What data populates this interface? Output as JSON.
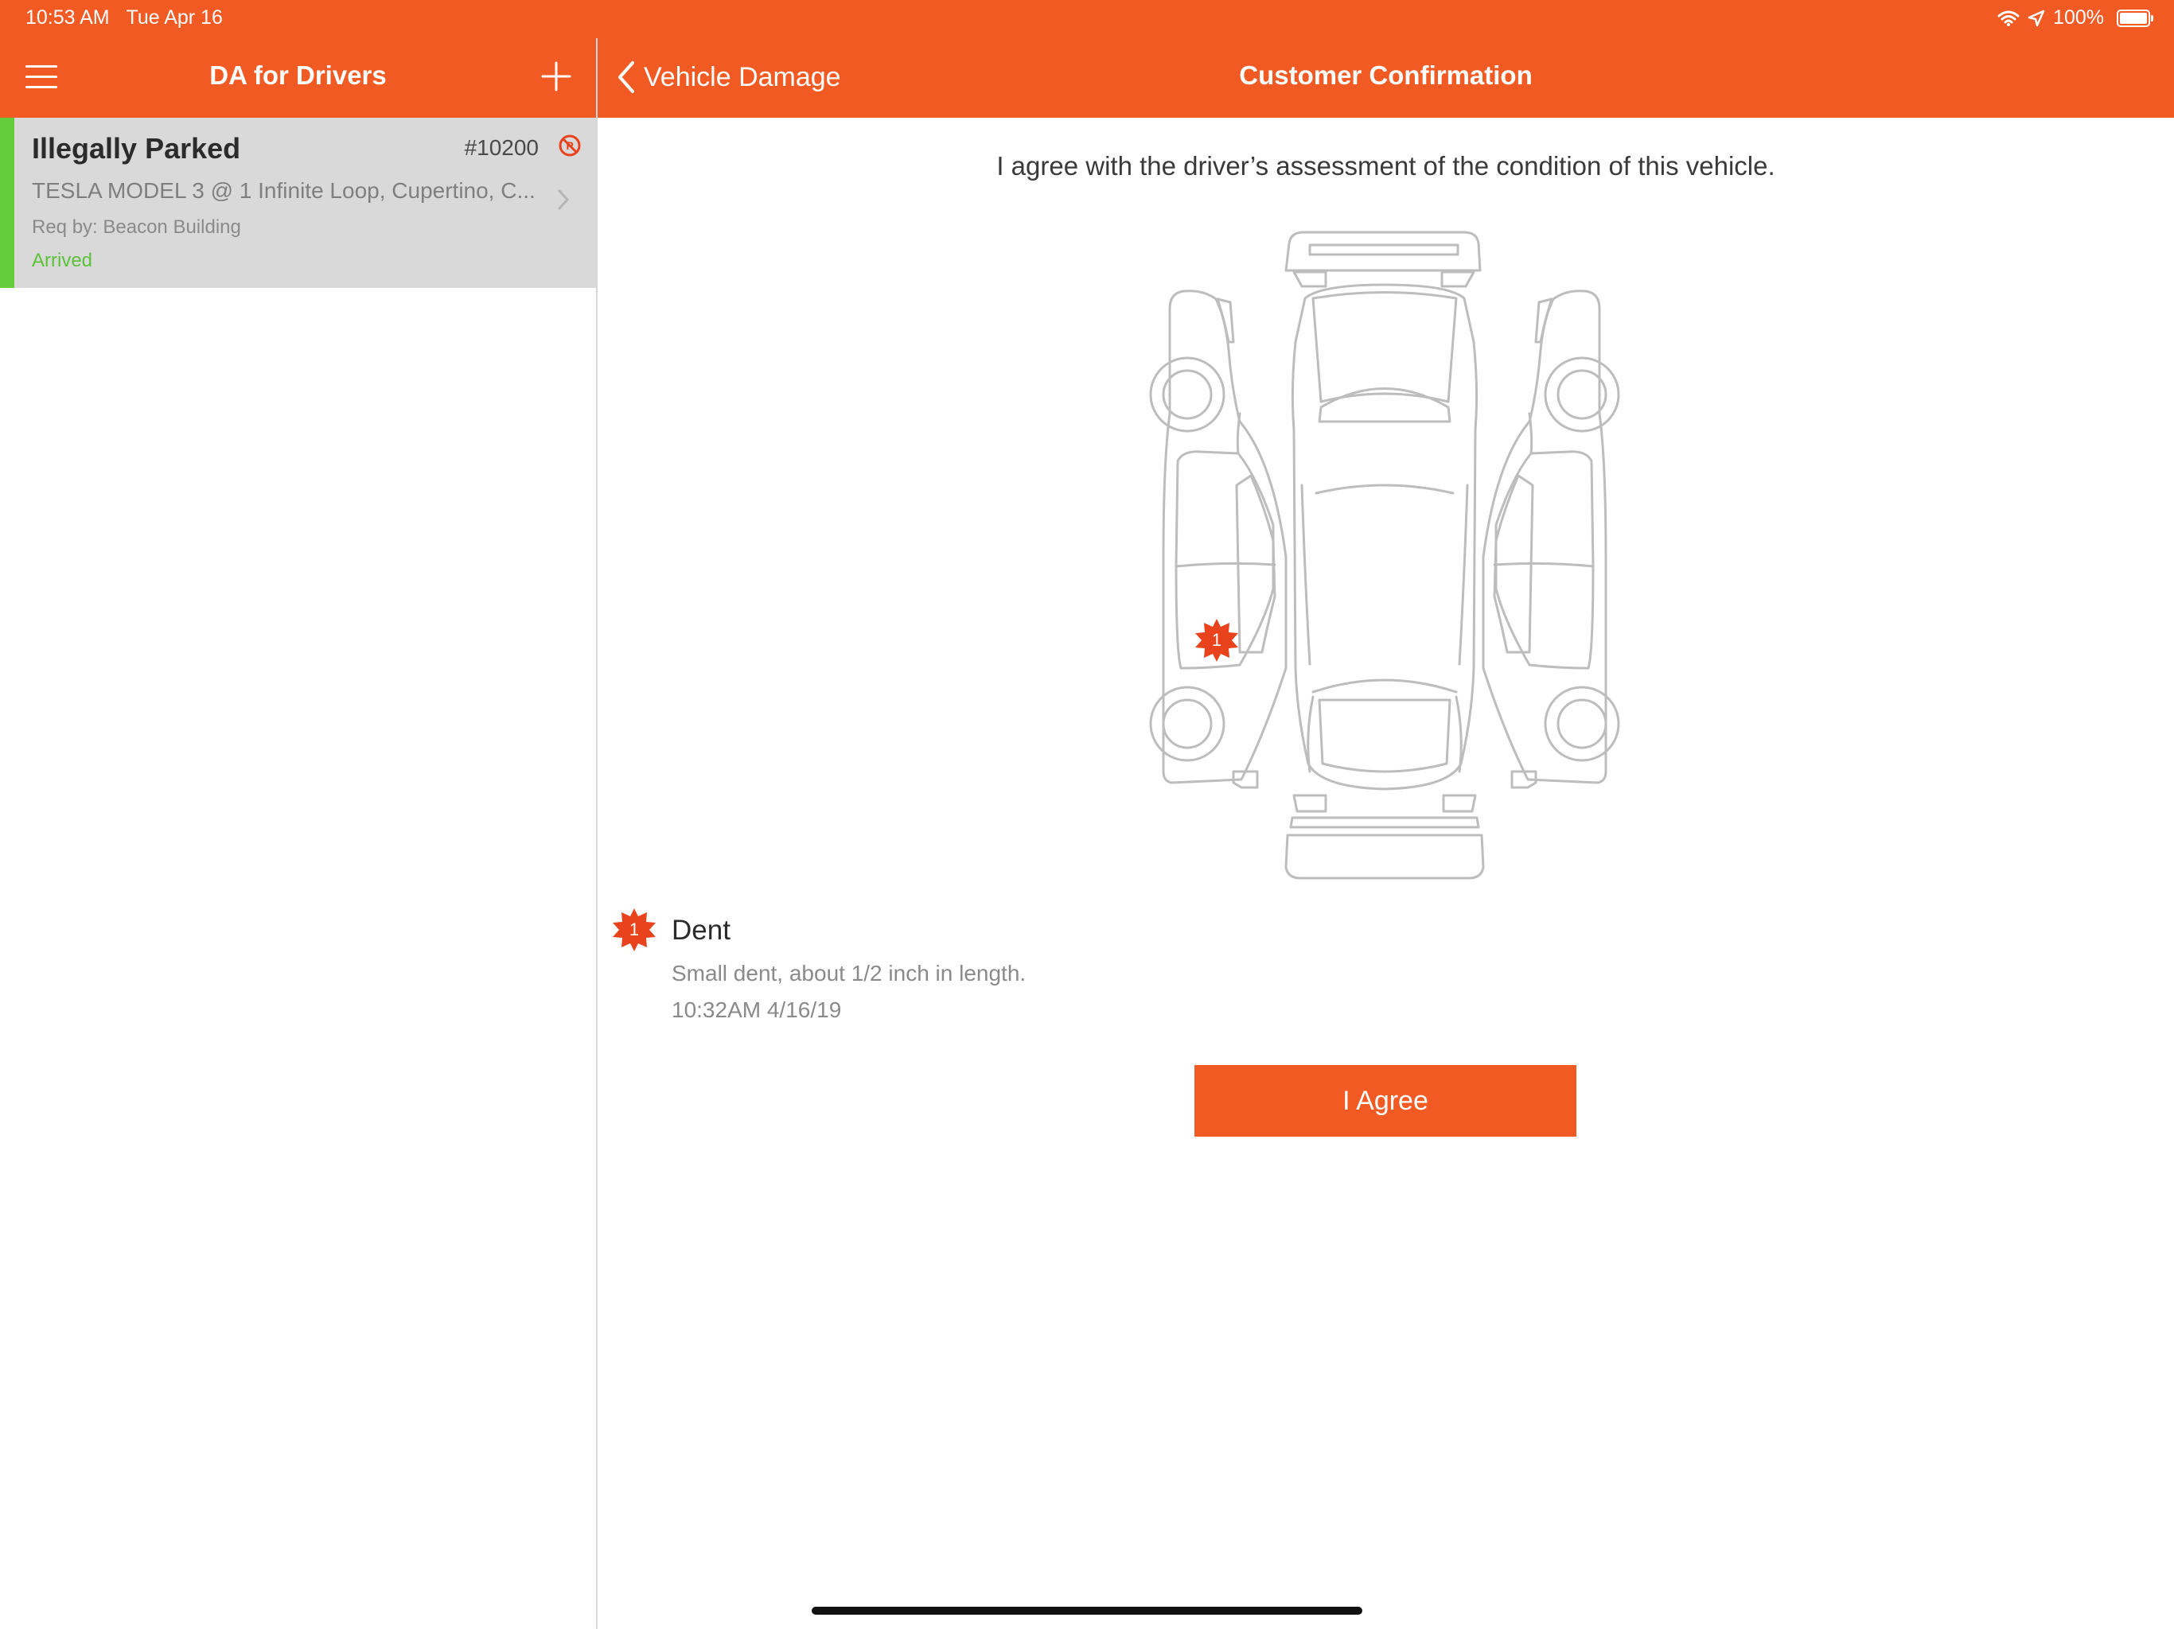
{
  "status_bar": {
    "time": "10:53 AM",
    "date": "Tue Apr 16",
    "battery_percent": "100%"
  },
  "sidebar": {
    "title": "DA for Drivers",
    "menu_icon": "hamburger-menu-icon",
    "add_icon": "plus-icon",
    "jobs": [
      {
        "title": "Illegally Parked",
        "number": "#10200",
        "vehicle_location": "TESLA MODEL 3 @ 1 Infinite Loop, Cupertino, C...",
        "requested_by": "Req by: Beacon Building",
        "status": "Arrived",
        "status_color": "#5cc23a",
        "stripe_color": "#63cc3b",
        "icon": "no-parking-icon"
      }
    ]
  },
  "main": {
    "back_label": "Vehicle Damage",
    "title": "Customer Confirmation",
    "agreement_text": "I agree with the driver’s assessment of the condition of this vehicle.",
    "damages": [
      {
        "index": "1",
        "type": "Dent",
        "description": "Small dent, about 1/2 inch in length.",
        "timestamp": "10:32AM 4/16/19"
      }
    ],
    "agree_button": "I Agree"
  },
  "colors": {
    "accent": "#f25a24",
    "marker": "#e8431c",
    "selected_cell": "#d9d9d9"
  }
}
